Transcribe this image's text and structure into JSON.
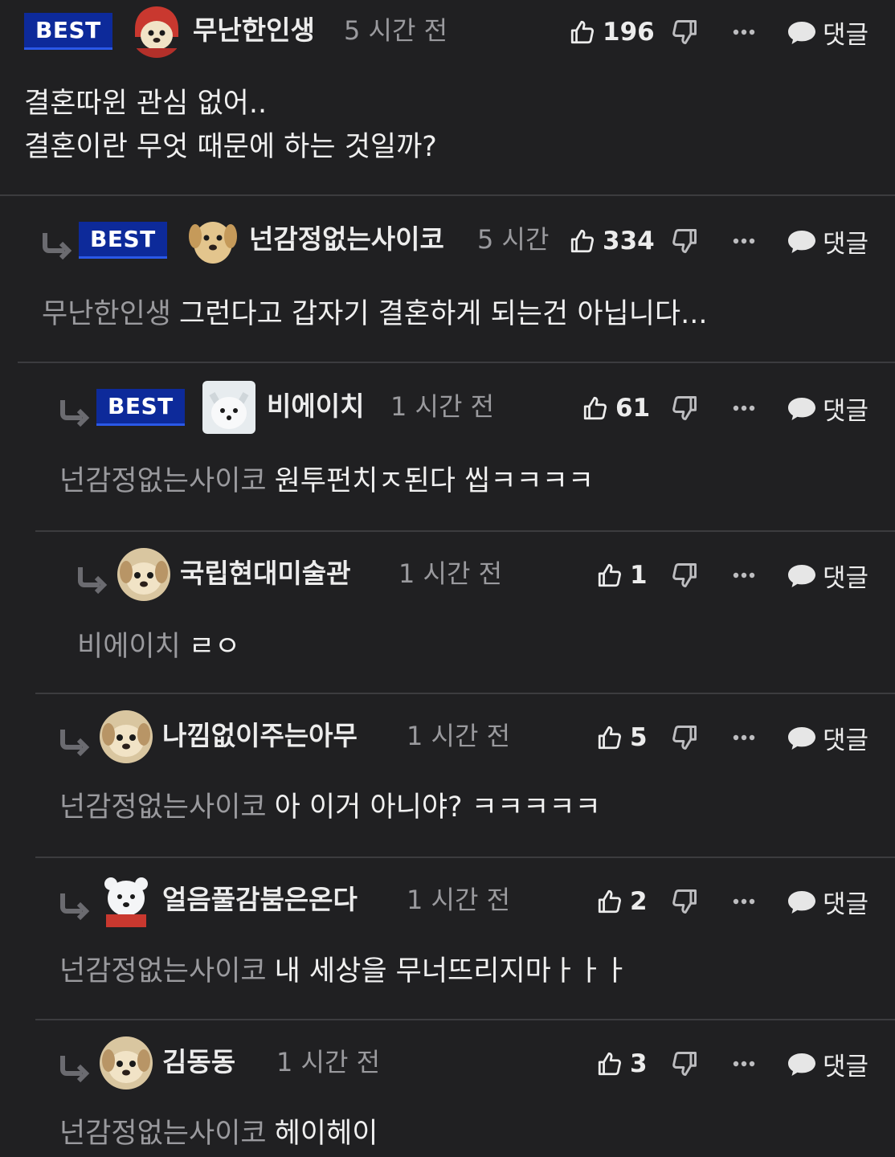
{
  "labels": {
    "best": "BEST",
    "reply": "댓글"
  },
  "comments": [
    {
      "nickname": "무난한인생",
      "time": "5 시간 전",
      "likes": "196",
      "best": true,
      "avatar": "puppy-hood-avatar",
      "body_lines": [
        "결혼따윈 관심 없어..",
        "결혼이란 무엇 때문에 하는 것일까?"
      ]
    },
    {
      "nickname": "넌감정없는사이코",
      "time": "5 시간",
      "likes": "334",
      "best": true,
      "avatar": "golden-puppy-avatar",
      "mention": "무난한인생",
      "body": "그런다고 갑자기 결혼하게 되는건 아닙니다..."
    },
    {
      "nickname": "비에이치",
      "time": "1 시간 전",
      "likes": "61",
      "best": true,
      "avatar": "arctic-fox-avatar",
      "mention": "넌감정없는사이코",
      "body": "원투펀치ㅈ된다 씹ㅋㅋㅋㅋ"
    },
    {
      "nickname": "국립현대미술관",
      "time": "1 시간 전",
      "likes": "1",
      "best": false,
      "avatar": "puppy-avatar",
      "mention": "비에이치",
      "body": "ㄹㅇ"
    },
    {
      "nickname": "나낌없이주는아무",
      "time": "1 시간 전",
      "likes": "5",
      "best": false,
      "avatar": "puppy-avatar",
      "mention": "넌감정없는사이코",
      "body": "아 이거 아니야? ㅋㅋㅋㅋㅋ"
    },
    {
      "nickname": "얼음풀감붐은온다",
      "time": "1 시간 전",
      "likes": "2",
      "best": false,
      "avatar": "polar-bear-avatar",
      "mention": "넌감정없는사이코",
      "body": "내 세상을 무너뜨리지마ㅏㅏㅏ"
    },
    {
      "nickname": "김동동",
      "time": "1 시간 전",
      "likes": "3",
      "best": false,
      "avatar": "puppy-avatar",
      "mention": "넌감정없는사이코",
      "body": "헤이헤이"
    }
  ]
}
